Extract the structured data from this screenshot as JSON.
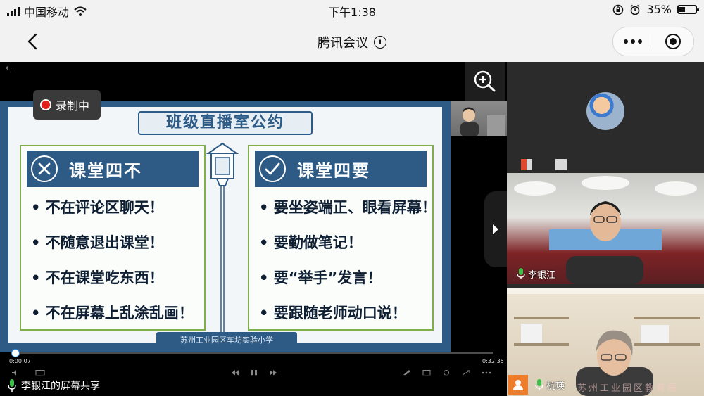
{
  "status_bar": {
    "carrier": "中国移动",
    "time": "下午1:38",
    "battery_percent": "35%",
    "battery_level": 0.35
  },
  "header": {
    "title": "腾讯会议",
    "info_icon": "i"
  },
  "meeting": {
    "recording_label": "录制中",
    "screen_share_label": "李银江的屏幕共享",
    "elapsed_time": "0:00:07",
    "total_time": "0:32:35",
    "progress": 0.004
  },
  "slide": {
    "title": "班级直播室公约",
    "left_panel": {
      "heading": "课堂四不",
      "rules": [
        "• 不在评论区聊天！",
        "• 不随意退出课堂！",
        "• 不在课堂吃东西！",
        "• 不在屏幕上乱涂乱画！"
      ]
    },
    "right_panel": {
      "heading": "课堂四要",
      "rules": [
        "• 要坐姿端正、眼看屏幕！",
        "• 要勤做笔记！",
        "• 要“举手”发言！",
        "• 要跟随老师动口说！"
      ]
    },
    "school_name": "苏州工业园区车坊实验小学"
  },
  "participants": [
    {
      "name": "李银江"
    },
    {
      "name": "杭瑛"
    }
  ],
  "watermark": "苏州工业园区教育局",
  "colors": {
    "slide_blue": "#2d5b86",
    "panel_green": "#7fae4b",
    "record_red": "#e21f1f",
    "progress_blue": "#2a83d6",
    "badge_orange": "#ee7d2b"
  }
}
